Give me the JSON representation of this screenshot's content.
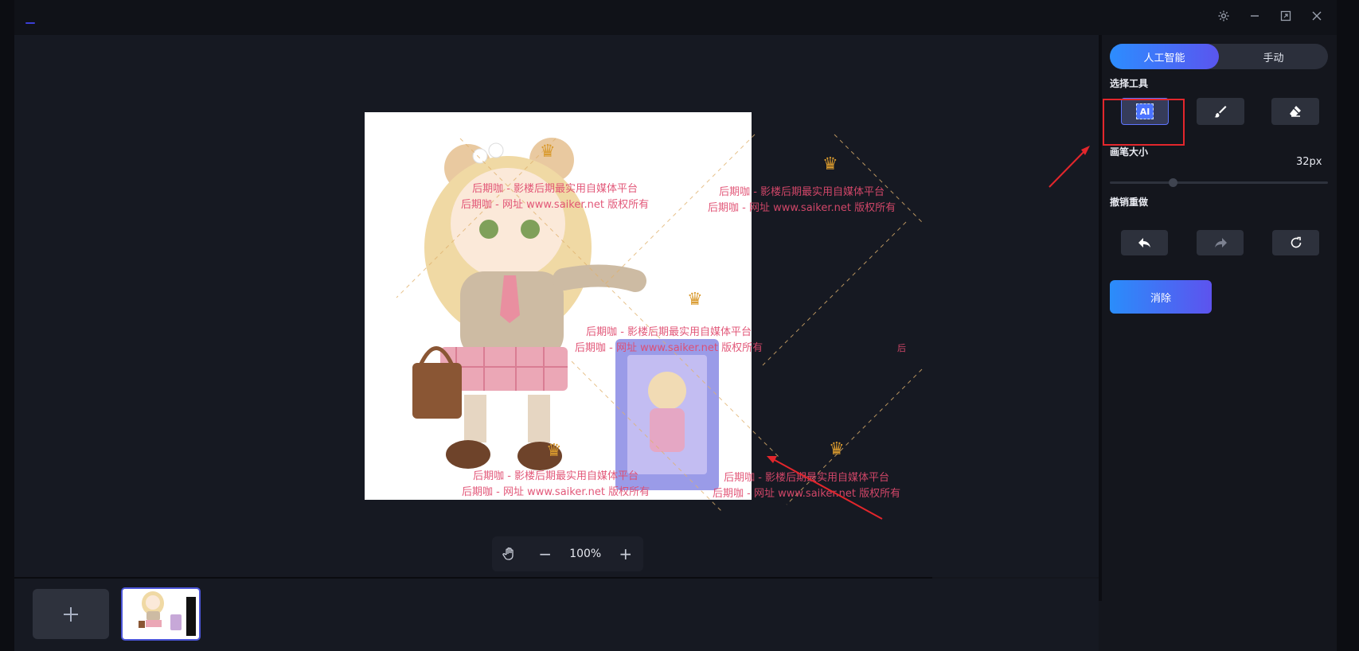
{
  "window": {
    "controls": [
      "settings-icon",
      "minimize-icon",
      "maximize-icon",
      "close-icon"
    ]
  },
  "canvas": {
    "image_alt": "doll product photo with package",
    "watermarks": [
      {
        "line1": "后期咖 - 影楼后期最实用自媒体平台",
        "line2": "后期咖 - 网址 www.saiker.net 版权所有"
      },
      {
        "line1": "后期咖 - 影楼后期最实用自媒体平台",
        "line2": "后期咖 - 网址 www.saiker.net 版权所有"
      },
      {
        "line1": "后期咖 - 影楼后期最实用自媒体平台",
        "line2": "后期咖 - 网址 www.saiker.net 版权所有"
      },
      {
        "line1": "后期咖 - 影楼后期最实用自媒体平台",
        "line2": "后期咖 - 网址 www.saiker.net 版权所有"
      },
      {
        "line1": "后期咖 - 影楼后期最实用自媒体平台",
        "line2": "后期咖 - 网址 www.saiker.net 版权所有"
      }
    ],
    "watermark_fragment": "后",
    "crown_glyph": "♛"
  },
  "zoom": {
    "value": "100%",
    "minus": "−",
    "plus": "+"
  },
  "panel": {
    "mode_ai": "人工智能",
    "mode_manual": "手动",
    "select_tool_label": "选择工具",
    "ai_tool_text": "AI",
    "brush_size_label": "画笔大小",
    "brush_size_value": "32px",
    "brush_size_fraction": 0.29,
    "undo_redo_label": "撤销重做",
    "erase_button": "消除"
  },
  "colors": {
    "accent_start": "#2c8dff",
    "accent_end": "#5a55ef",
    "highlight_red": "#e3262c",
    "watermark_pink": "#e04a6e"
  }
}
